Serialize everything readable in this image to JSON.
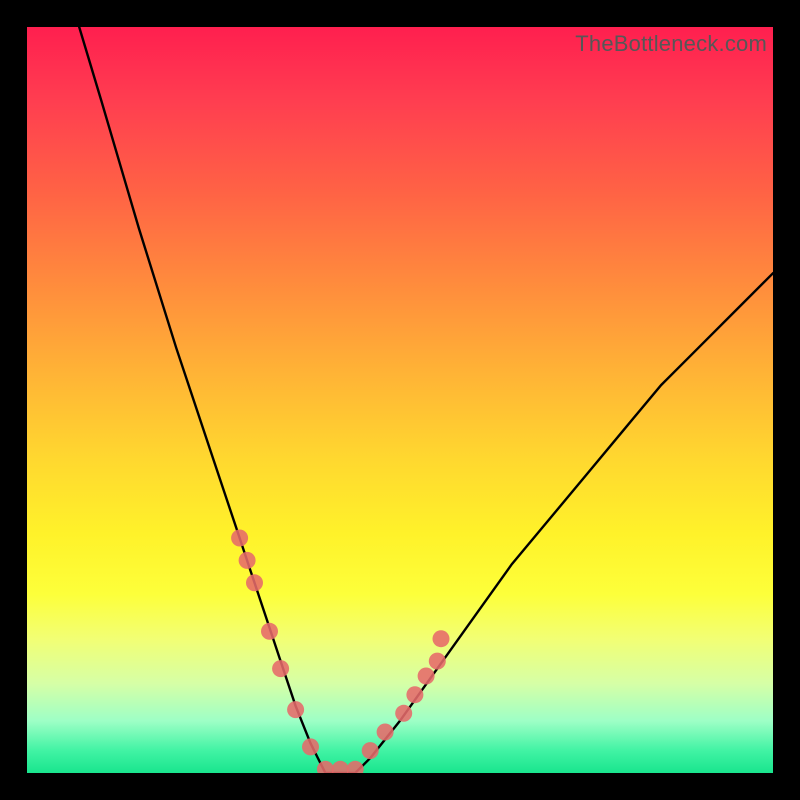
{
  "watermark": "TheBottleneck.com",
  "chart_data": {
    "type": "line",
    "title": "",
    "xlabel": "",
    "ylabel": "",
    "xlim": [
      0,
      100
    ],
    "ylim": [
      0,
      100
    ],
    "series": [
      {
        "name": "bottleneck-curve",
        "x": [
          7,
          10,
          15,
          20,
          25,
          28,
          30,
          32,
          34,
          36,
          38,
          39,
          40,
          42,
          44,
          46,
          50,
          55,
          60,
          65,
          70,
          75,
          80,
          85,
          90,
          95,
          100
        ],
        "values": [
          100,
          90,
          73,
          57,
          42,
          33,
          27,
          21,
          15,
          9,
          4,
          2,
          0,
          0,
          0,
          2,
          7,
          14,
          21,
          28,
          34,
          40,
          46,
          52,
          57,
          62,
          67
        ]
      }
    ],
    "markers": {
      "name": "highlight-points",
      "color": "#e66a6a",
      "x": [
        28.5,
        29.5,
        30.5,
        32.5,
        34.0,
        36.0,
        38.0,
        40.0,
        42.0,
        44.0,
        46.0,
        48.0,
        50.5,
        52.0,
        53.5,
        55.0,
        55.5
      ],
      "values": [
        31.5,
        28.5,
        25.5,
        19.0,
        14.0,
        8.5,
        3.5,
        0.5,
        0.5,
        0.5,
        3.0,
        5.5,
        8.0,
        10.5,
        13.0,
        15.0,
        18.0
      ]
    },
    "gradient_theme": "rainbow-heat",
    "legend": false,
    "grid": false
  }
}
